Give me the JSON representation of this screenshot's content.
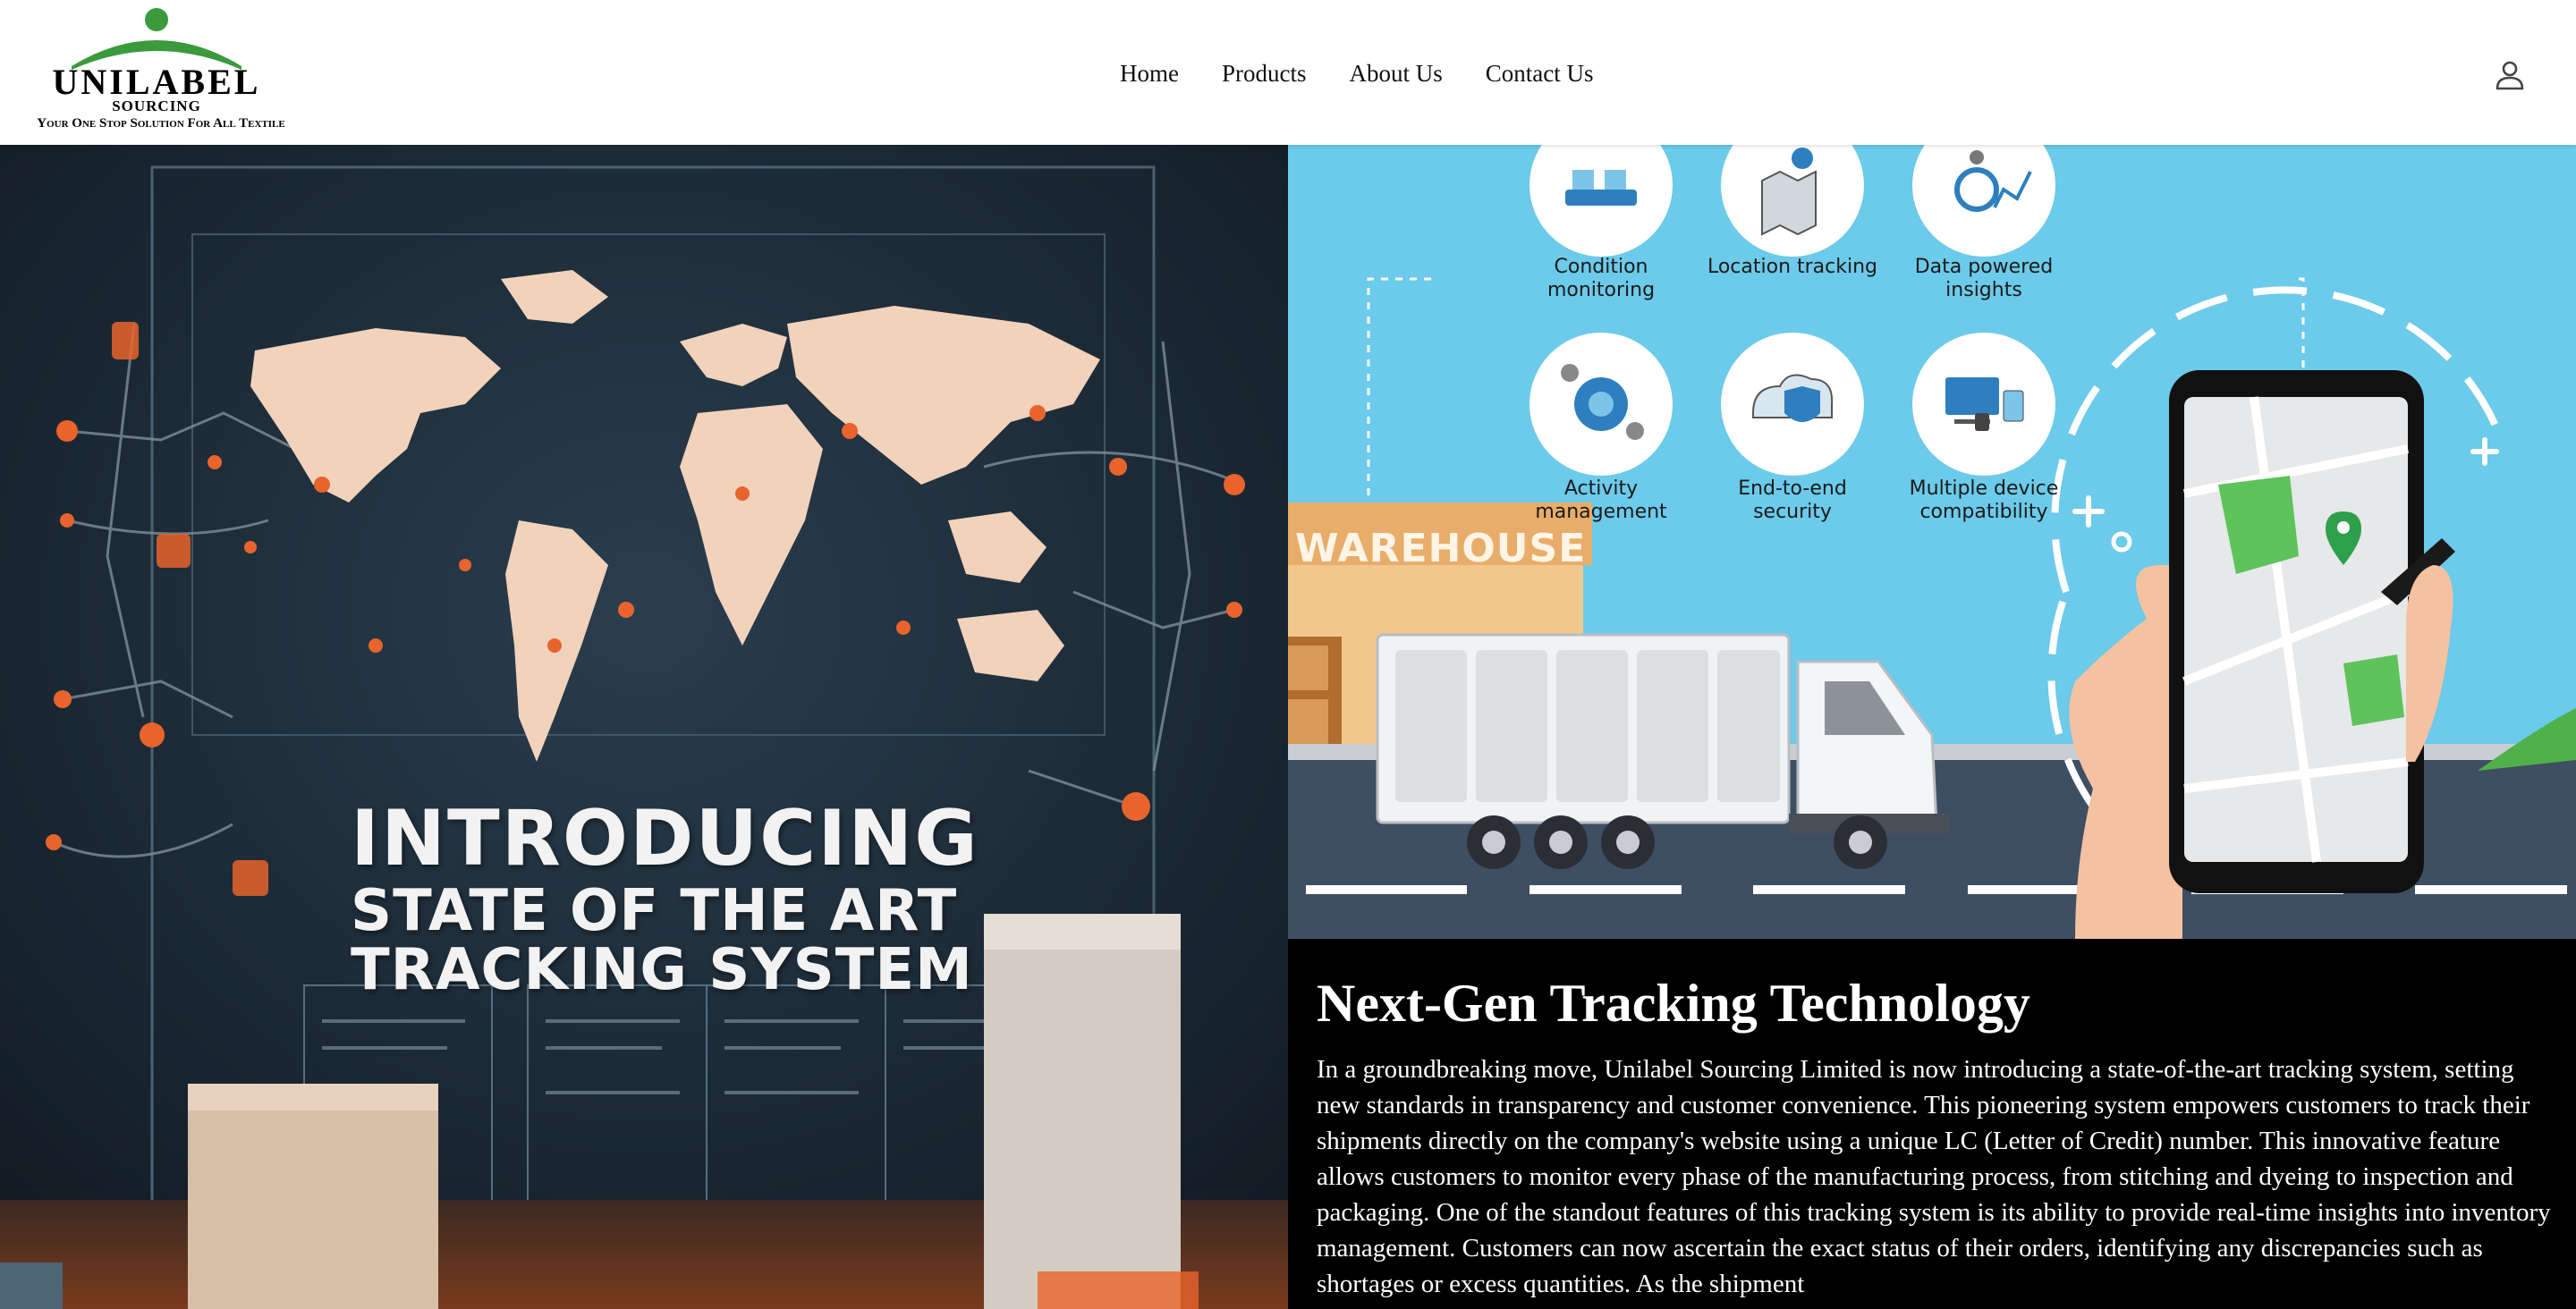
{
  "header": {
    "logo": {
      "name": "UNILABEL",
      "sub": "SOURCING",
      "tagline": "Your One Stop Solution For All Textile"
    },
    "nav": [
      "Home",
      "Products",
      "About Us",
      "Contact Us"
    ],
    "account_icon": "user-account-icon"
  },
  "hero": {
    "line1": "INTRODUCING",
    "line2": "STATE OF THE ART",
    "line3": "TRACKING SYSTEM"
  },
  "illustration": {
    "features": [
      {
        "label": "Condition monitoring",
        "icon": "conveyor-icon"
      },
      {
        "label": "Location tracking",
        "icon": "map-pin-icon"
      },
      {
        "label": "Data powered insights",
        "icon": "analytics-icon"
      },
      {
        "label": "Activity management",
        "icon": "gear-globe-icon"
      },
      {
        "label": "End-to-end security",
        "icon": "shield-cloud-icon"
      },
      {
        "label": "Multiple device compatibility",
        "icon": "devices-icon"
      }
    ],
    "warehouse_sign": "WAREHOUSE"
  },
  "article": {
    "title": "Next-Gen Tracking Technology",
    "body": "In a groundbreaking move, Unilabel Sourcing Limited is now introducing a state-of-the-art tracking system, setting new standards in transparency and customer convenience. This pioneering system empowers customers to track their shipments directly on the company's website using a unique LC (Letter of Credit) number. This innovative feature allows customers to monitor every phase of the manufacturing process, from stitching and dyeing to inspection and packaging. One of the standout features of this tracking system is its ability to provide real-time insights into inventory management. Customers can now ascertain the exact status of their orders, identifying any discrepancies such as shortages or excess quantities. As the shipment"
  },
  "colors": {
    "logo_green": "#3a9a3c",
    "map_bg": "#1c2b38",
    "continent": "#f1d2bb",
    "accent_orange": "#e8642c",
    "sky_blue": "#6ccaea",
    "article_bg": "#000000"
  }
}
